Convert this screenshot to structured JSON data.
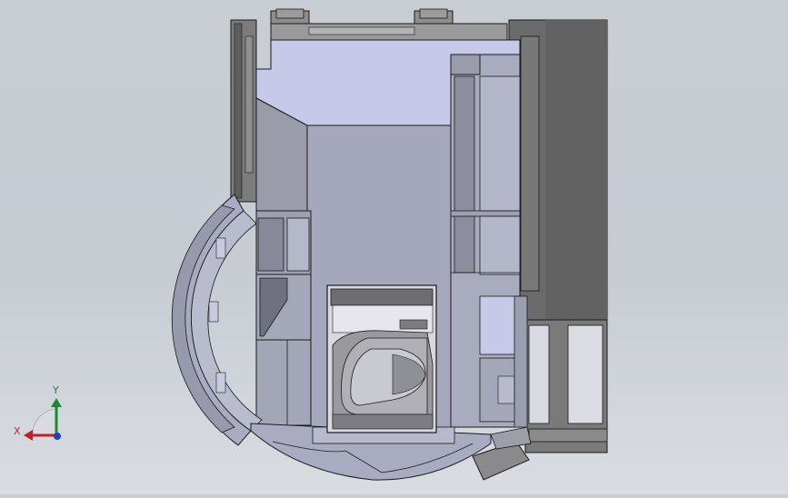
{
  "viewport": {
    "background_top": "#c9ced5",
    "background_bottom": "#d9dde2"
  },
  "triad": {
    "x_label": "X",
    "y_label": "Y",
    "x_color": "#c0202a",
    "y_color": "#1a8a2a",
    "z_color": "#1f3fbf"
  },
  "model": {
    "edge_color": "#1a1a1a",
    "face_light": "#c6c9e8",
    "face_mid": "#a8abc0",
    "face_dark": "#6e6e6e"
  }
}
